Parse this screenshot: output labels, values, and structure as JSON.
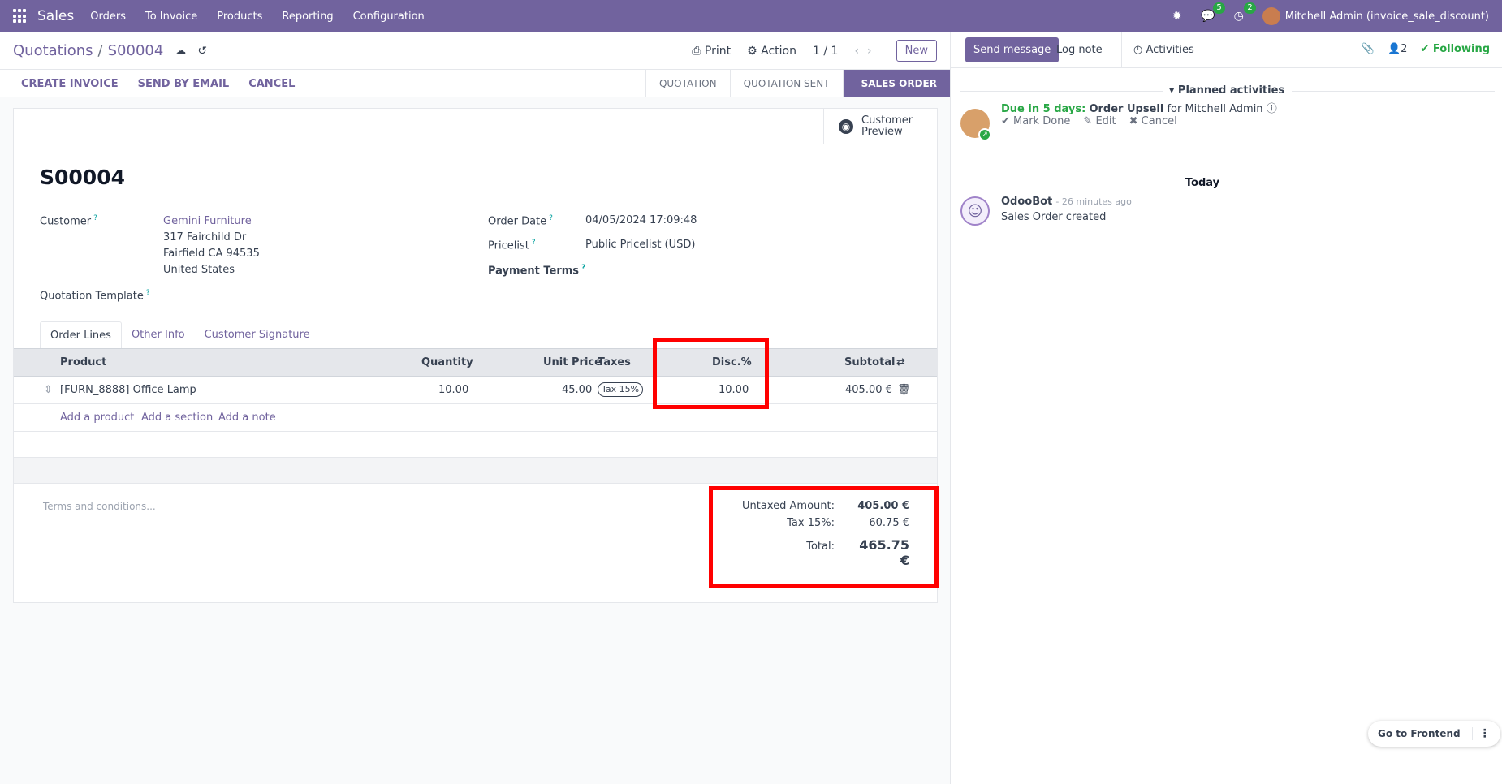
{
  "navbar": {
    "app_name": "Sales",
    "menu": [
      "Orders",
      "To Invoice",
      "Products",
      "Reporting",
      "Configuration"
    ],
    "messages_count": "5",
    "activities_count": "2",
    "user": "Mitchell Admin (invoice_sale_discount)"
  },
  "breadcrumb": {
    "parent": "Quotations",
    "current": "S00004"
  },
  "control": {
    "print": "Print",
    "action": "Action",
    "pager": "1 / 1",
    "new": "New"
  },
  "status": {
    "actions": [
      "CREATE INVOICE",
      "SEND BY EMAIL",
      "CANCEL"
    ],
    "stages": [
      "QUOTATION",
      "QUOTATION SENT",
      "SALES ORDER"
    ],
    "active_stage": "SALES ORDER"
  },
  "form": {
    "preview_line1": "Customer",
    "preview_line2": "Preview",
    "name": "S00004",
    "customer_label": "Customer",
    "customer_name": "Gemini Furniture",
    "address": [
      "317 Fairchild Dr",
      "Fairfield CA 94535",
      "United States"
    ],
    "template_label": "Quotation Template",
    "order_date_label": "Order Date",
    "order_date": "04/05/2024 17:09:48",
    "pricelist_label": "Pricelist",
    "pricelist": "Public Pricelist (USD)",
    "payment_terms_label": "Payment Terms"
  },
  "tabs": [
    "Order Lines",
    "Other Info",
    "Customer Signature"
  ],
  "table": {
    "headers": {
      "product": "Product",
      "quantity": "Quantity",
      "unit_price": "Unit Price",
      "taxes": "Taxes",
      "disc": "Disc.%",
      "subtotal": "Subtotal"
    },
    "rows": [
      {
        "product": "[FURN_8888] Office Lamp",
        "quantity": "10.00",
        "unit_price": "45.00",
        "tax": "Tax 15%",
        "disc": "10.00",
        "subtotal": "405.00 €"
      }
    ],
    "add_links": [
      "Add a product",
      "Add a section",
      "Add a note"
    ]
  },
  "terms_placeholder": "Terms and conditions...",
  "totals": {
    "untaxed_label": "Untaxed Amount:",
    "untaxed": "405.00 €",
    "tax_label": "Tax 15%:",
    "tax": "60.75 €",
    "total_label": "Total:",
    "total": "465.75 €"
  },
  "chatter": {
    "send_message": "Send message",
    "log_note": "Log note",
    "activities": "Activities",
    "followers_count": "2",
    "following": "Following",
    "planned_title": "Planned activities",
    "activity_due": "Due in 5 days:",
    "activity_name": "Order Upsell",
    "activity_for": "for Mitchell Admin",
    "mark_done": "Mark Done",
    "edit": "Edit",
    "cancel": "Cancel",
    "today": "Today",
    "msg_author": "OdooBot",
    "msg_time": "- 26 minutes ago",
    "msg_body": "Sales Order created"
  },
  "frontend_button": "Go to Frontend"
}
